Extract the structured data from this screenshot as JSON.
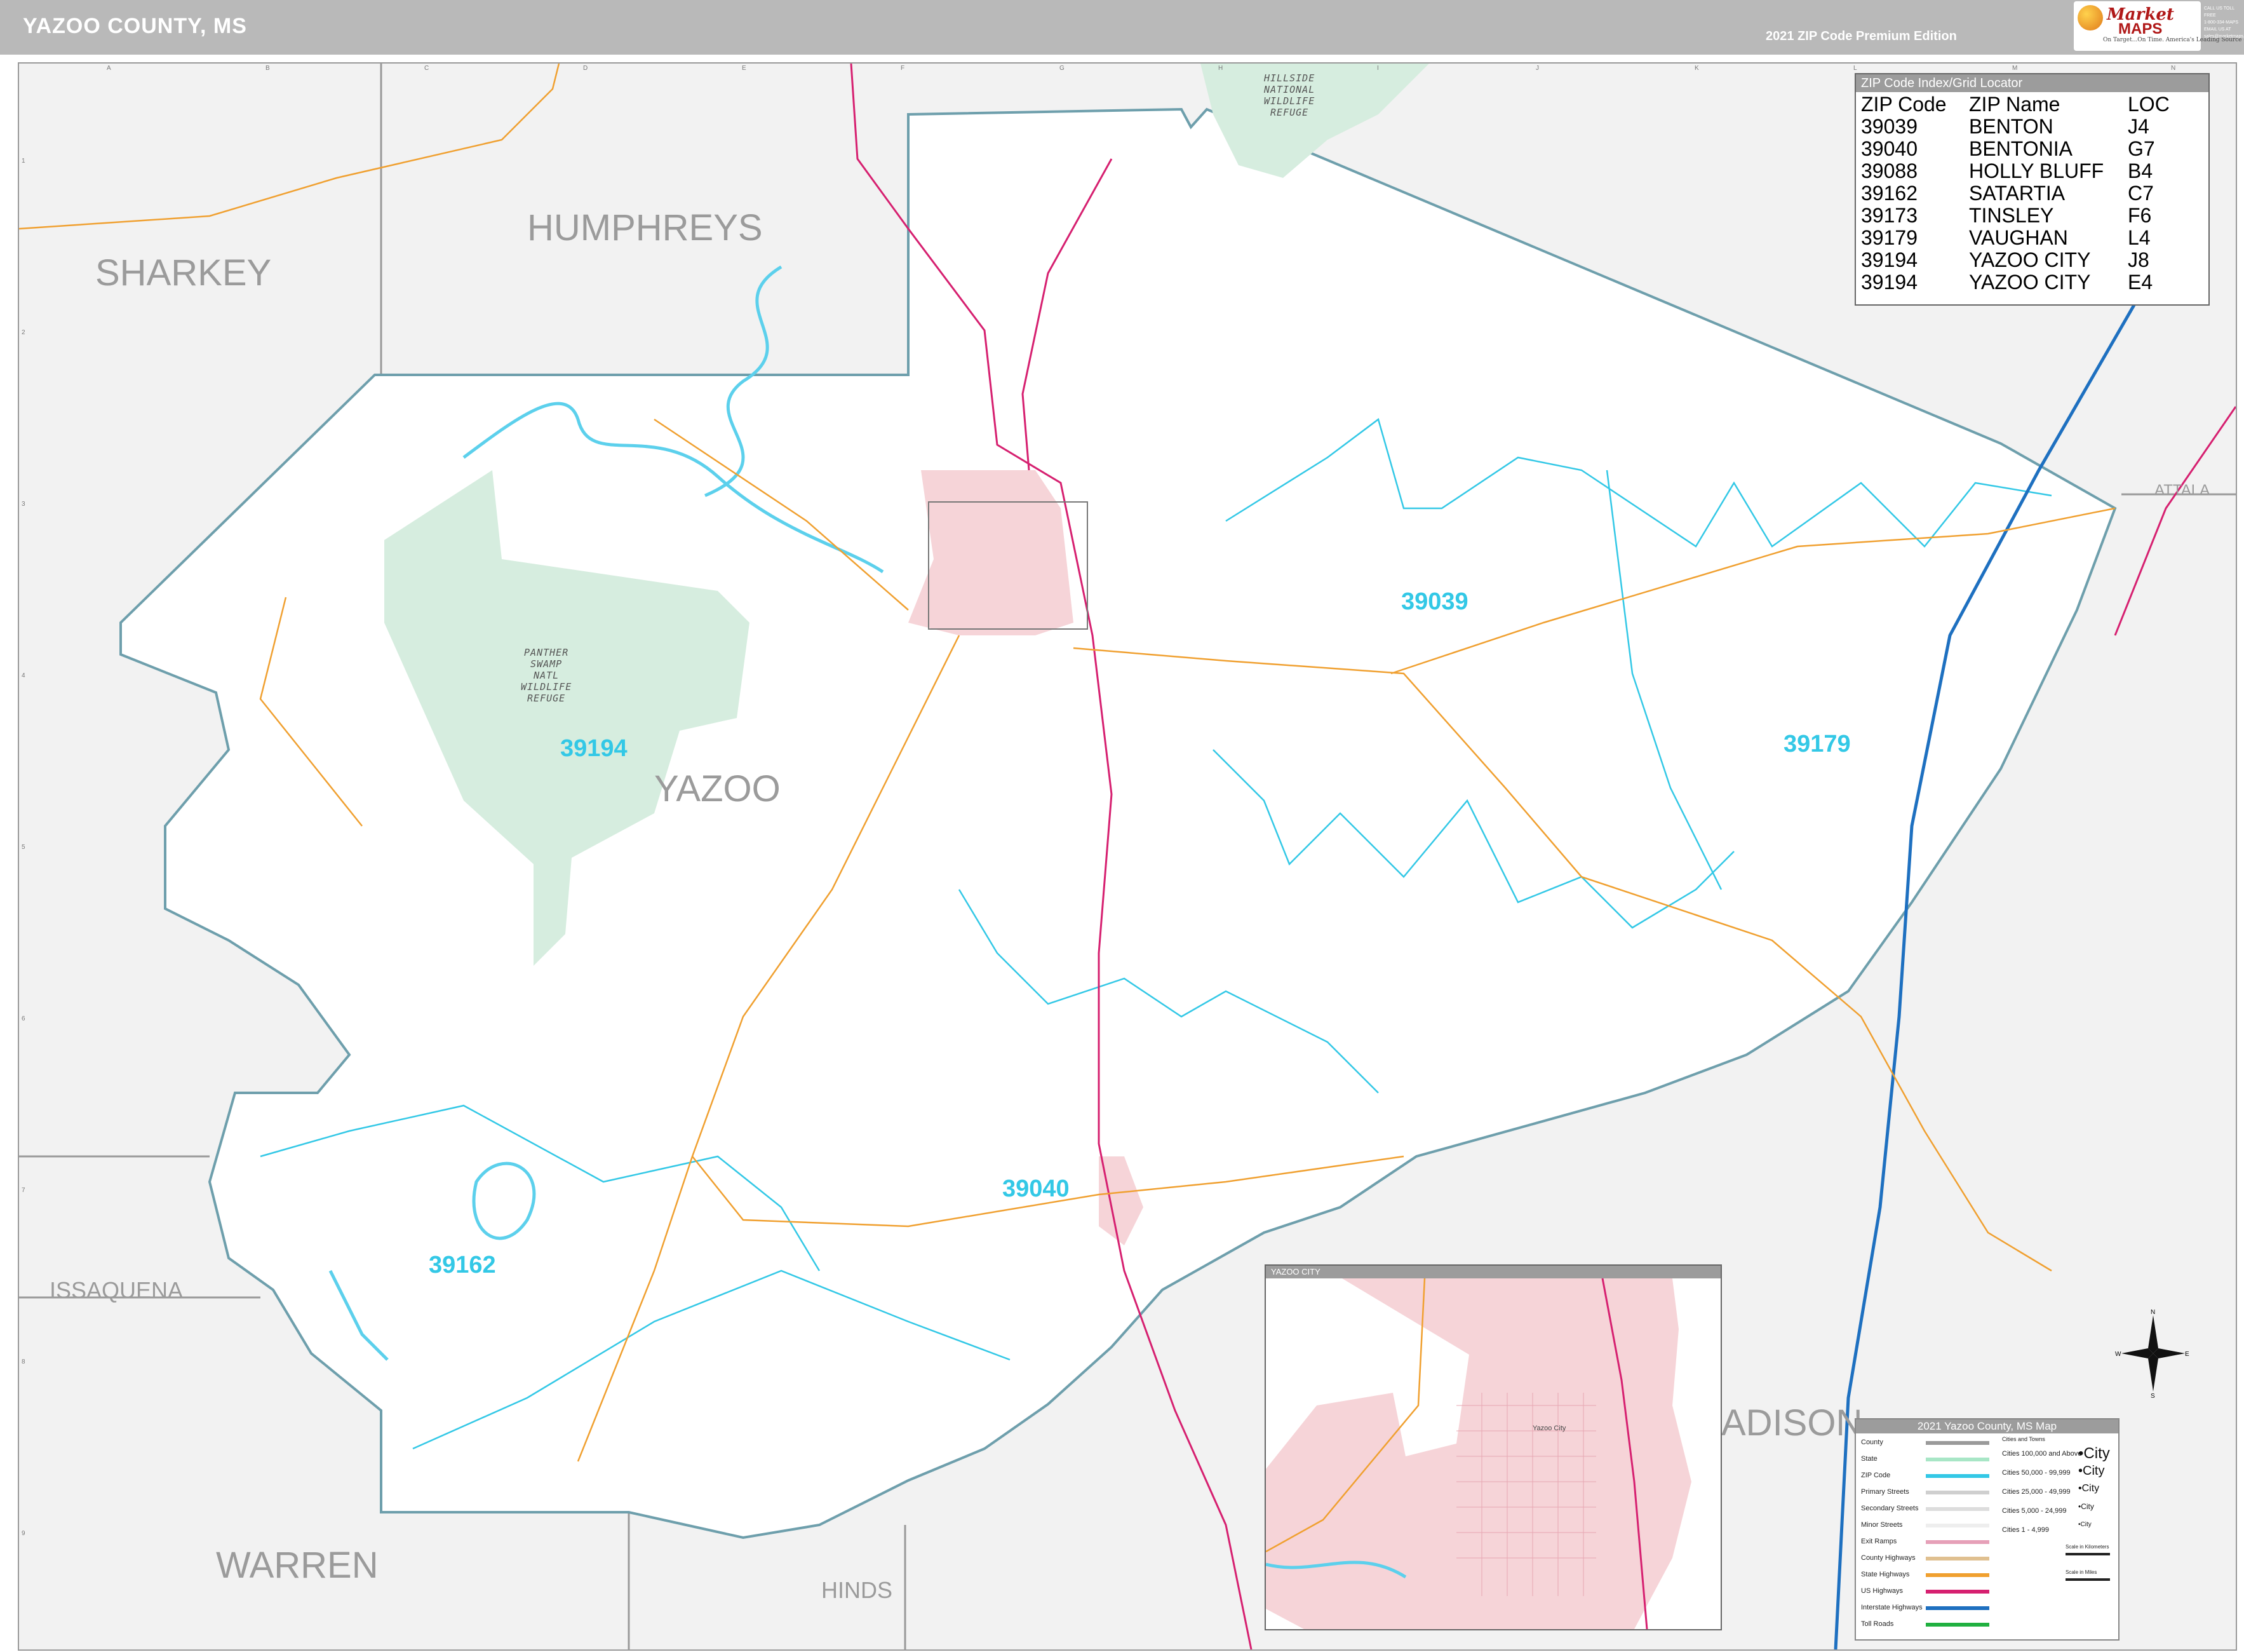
{
  "header": {
    "title": "YAZOO COUNTY, MS",
    "edition": "2021 ZIP Code Premium Edition"
  },
  "logo": {
    "brand_line1": "Market",
    "brand_line2": "MAPS",
    "tagline": "On Target...On Time. America's Leading Source of Business Maps",
    "icon": "globe-logo-icon"
  },
  "contact": {
    "lines": [
      "CALL US TOLL FREE",
      "1-800-334-MAPS",
      "EMAIL US AT",
      "sales@marketmaps.com"
    ]
  },
  "counties": {
    "sharkey": "SHARKEY",
    "humphreys": "HUMPHREYS",
    "yazoo": "YAZOO",
    "issaquena": "ISSAQUENA",
    "warren": "WARREN",
    "hinds": "HINDS",
    "madison": "ADISON",
    "attala": "ATTALA"
  },
  "refuges": {
    "hillside": "HILLSIDE\nNATIONAL\nWILDLIFE\nREFUGE",
    "panther": "PANTHER\nSWAMP\nNATL\nWILDLIFE\nREFUGE"
  },
  "zip_labels": {
    "z39039": "39039",
    "z39194": "39194",
    "z39179": "39179",
    "z39040": "39040",
    "z39162": "39162"
  },
  "zip_index": {
    "title": "ZIP Code Index/Grid Locator",
    "columns": [
      "ZIP Code",
      "ZIP Name",
      "LOC"
    ],
    "rows": [
      [
        "39039",
        "BENTON",
        "J4"
      ],
      [
        "39040",
        "BENTONIA",
        "G7"
      ],
      [
        "39088",
        "HOLLY BLUFF",
        "B4"
      ],
      [
        "39162",
        "SATARTIA",
        "C7"
      ],
      [
        "39173",
        "TINSLEY",
        "F6"
      ],
      [
        "39179",
        "VAUGHAN",
        "L4"
      ],
      [
        "39194",
        "YAZOO CITY",
        "J8"
      ],
      [
        "39194",
        "YAZOO CITY",
        "E4"
      ]
    ]
  },
  "legend": {
    "title": "2021 Yazoo County, MS Map",
    "items": [
      {
        "label": "County",
        "color": "#9a9a9a"
      },
      {
        "label": "State",
        "color": "#a8e6c6"
      },
      {
        "label": "ZIP Code",
        "color": "#33c8e6"
      },
      {
        "label": "Primary Streets",
        "color": "#cfcfcf"
      },
      {
        "label": "Secondary Streets",
        "color": "#dddddd"
      },
      {
        "label": "Minor Streets",
        "color": "#eeeeee"
      },
      {
        "label": "Exit Ramps",
        "color": "#e6a0b8"
      },
      {
        "label": "County Highways",
        "color": "#e0c090"
      },
      {
        "label": "State Highways",
        "color": "#f0a030"
      },
      {
        "label": "US Highways",
        "color": "#d62070"
      },
      {
        "label": "Interstate Highways",
        "color": "#1e70c0"
      },
      {
        "label": "Toll Roads",
        "color": "#20b040"
      }
    ],
    "city_header": "Cities and Towns",
    "cities": [
      {
        "label": "Cities 100,000 and Above",
        "sample": "•City"
      },
      {
        "label": "Cities 50,000 - 99,999",
        "sample": "•City"
      },
      {
        "label": "Cities 25,000 - 49,999",
        "sample": "•City"
      },
      {
        "label": "Cities 5,000 - 24,999",
        "sample": "•City"
      },
      {
        "label": "Cities 1 - 4,999",
        "sample": "•City"
      }
    ],
    "scale_km": "Scale in Kilometers",
    "scale_mi": "Scale in Miles"
  },
  "inset": {
    "title": "YAZOO CITY",
    "city_label": "Yazoo City"
  },
  "grid": {
    "columns": [
      "A",
      "B",
      "C",
      "D",
      "E",
      "F",
      "G",
      "H",
      "I",
      "J",
      "K",
      "L",
      "M",
      "N"
    ],
    "rows": [
      "1",
      "2",
      "3",
      "4",
      "5",
      "6",
      "7",
      "8",
      "9"
    ]
  },
  "colors": {
    "county_fill": "#ffffff",
    "outside_fill": "#f2f2f2",
    "refuge_fill": "#d6eddf",
    "city_fill": "#f6d4d8",
    "water": "#5cd0ec",
    "county_border": "#6e9fac",
    "zip_line": "#33c8e6",
    "state_hwy": "#f0a030",
    "us_hwy": "#d62070",
    "interstate": "#1e70c0"
  },
  "compass": {
    "n": "N",
    "s": "S",
    "e": "E",
    "w": "W",
    "icon": "compass-rose-icon"
  }
}
